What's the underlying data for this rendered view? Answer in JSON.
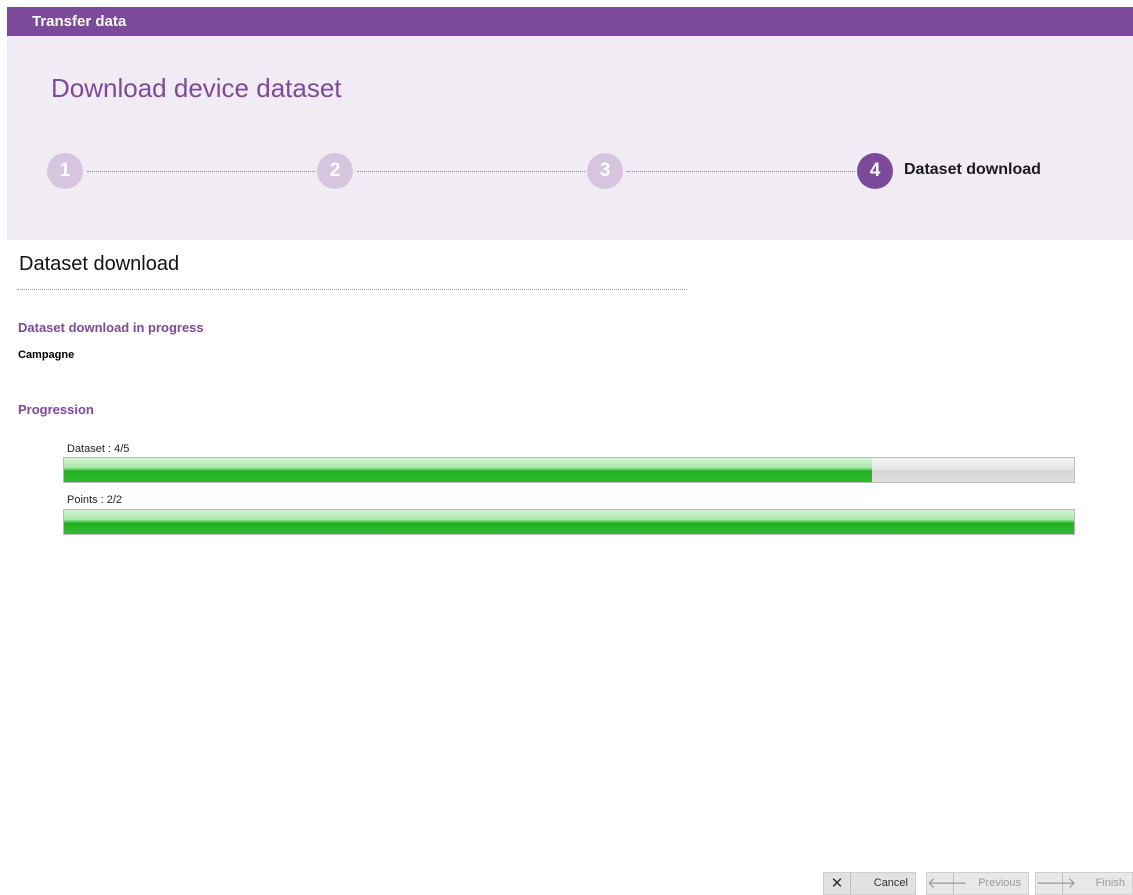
{
  "window": {
    "title": "Transfer data"
  },
  "wizard": {
    "title": "Download device dataset",
    "steps": [
      {
        "number": "1",
        "icon": "step-1-circle"
      },
      {
        "number": "2",
        "icon": "step-2-circle"
      },
      {
        "number": "3",
        "icon": "step-3-circle"
      },
      {
        "number": "4",
        "icon": "step-4-circle",
        "label": "Dataset download",
        "active": true
      }
    ],
    "accent_color": "#7d4a9b"
  },
  "content": {
    "section_title": "Dataset download",
    "status_heading": "Dataset download in progress",
    "campaign_name": "Campagne",
    "progression_heading": "Progression",
    "progress": [
      {
        "label": "Dataset : 4/5",
        "fraction": 0.8
      },
      {
        "label": "Points : 2/2",
        "fraction": 1.0
      }
    ]
  },
  "footer": {
    "cancel_label": "Cancel",
    "previous_label": "Previous",
    "finish_label": "Finish",
    "icons": {
      "cancel": "close-icon",
      "previous": "arrow-left-icon",
      "finish": "arrow-right-icon"
    }
  }
}
